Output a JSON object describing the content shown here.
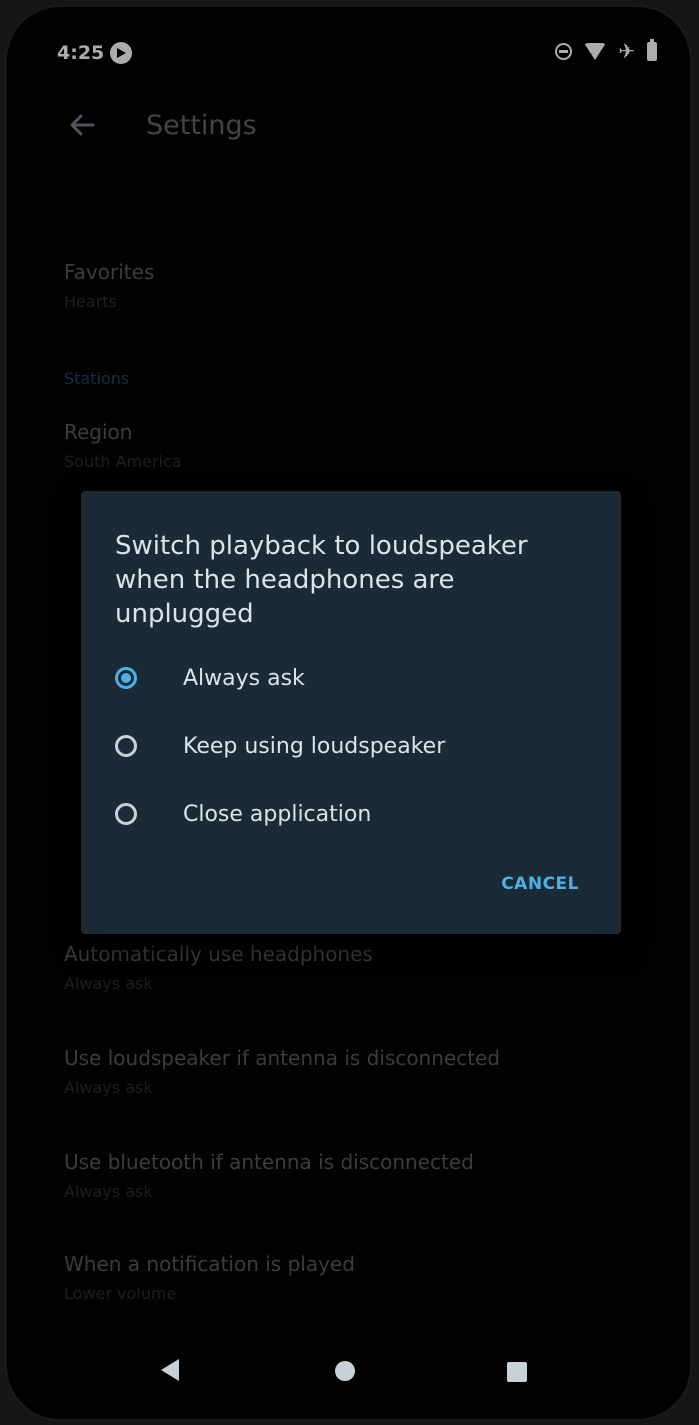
{
  "status_bar": {
    "time": "4:25",
    "icons": [
      "play-circle-icon",
      "do-not-disturb-icon",
      "wifi-icon",
      "airplane-mode-icon",
      "battery-icon"
    ]
  },
  "app_bar": {
    "back_icon": "arrow-left-icon",
    "title": "Settings"
  },
  "settings": {
    "favorites": {
      "title": "Favorites",
      "summary": "Hearts"
    },
    "stations_header": "Stations",
    "region": {
      "title": "Region",
      "summary": "South America"
    },
    "auto_headphones": {
      "title": "Automatically use headphones",
      "summary": "Always ask"
    },
    "loudspeaker_antenna": {
      "title": "Use loudspeaker if antenna is disconnected",
      "summary": "Always ask"
    },
    "bluetooth_antenna": {
      "title": "Use bluetooth if antenna is disconnected",
      "summary": "Always ask"
    },
    "notification": {
      "title": "When a notification is played",
      "summary": "Lower volume"
    }
  },
  "dialog": {
    "title": "Switch playback to loudspeaker when the headphones are unplugged",
    "options": [
      {
        "label": "Always ask",
        "checked": true
      },
      {
        "label": "Keep using loudspeaker",
        "checked": false
      },
      {
        "label": "Close application",
        "checked": false
      }
    ],
    "cancel_label": "CANCEL"
  },
  "colors": {
    "accent": "#4fb0e6",
    "dialog_bg": "#1a2a36",
    "screen_bg": "#030303"
  },
  "nav_bar": {
    "back_icon": "triangle-back-icon",
    "home_icon": "circle-home-icon",
    "recents_icon": "square-recents-icon"
  }
}
